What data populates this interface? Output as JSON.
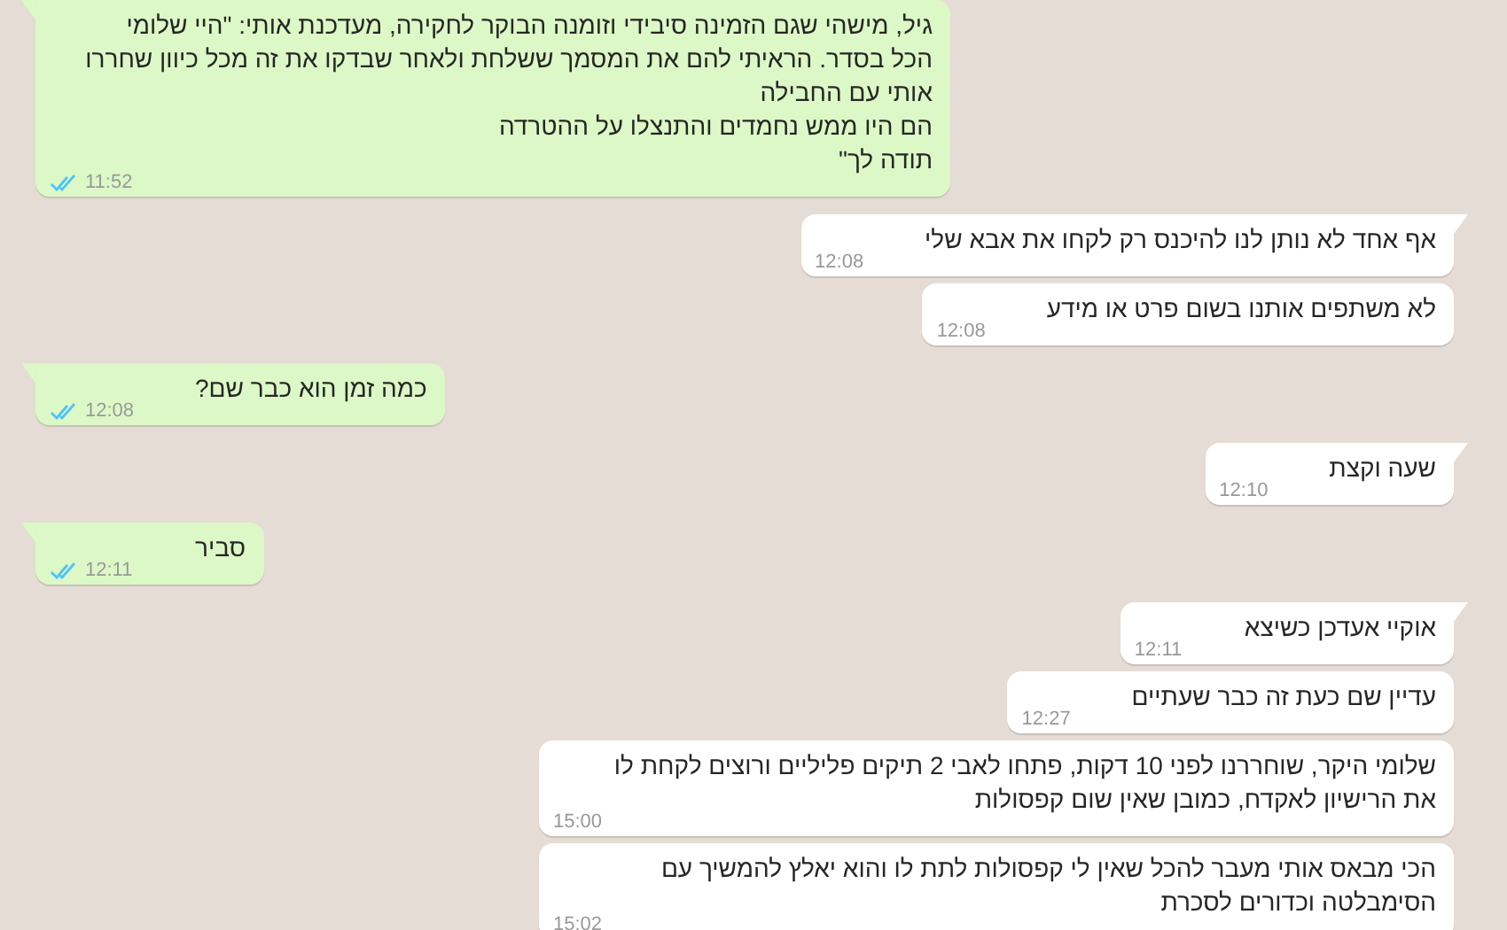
{
  "messages": [
    {
      "kind": "sent",
      "tail": true,
      "paragraphs": [
        "גיל, מישהי שגם הזמינה סיבידי וזומנה הבוקר לחקירה, מעדכנת אותי: \"היי שלומי הכל בסדר. הראיתי להם את המסמך ששלחת ולאחר שבדקו את זה מכל כיוון שחררו אותי עם החבילה",
        "הם היו ממש נחמדים והתנצלו על ההטרדה",
        "תודה לך\""
      ],
      "time": "11:52",
      "read": true
    },
    {
      "kind": "received",
      "tail": true,
      "paragraphs": [
        "אף אחד לא נותן לנו להיכנס רק לקחו את אבא שלי"
      ],
      "time": "12:08"
    },
    {
      "kind": "received",
      "tail": false,
      "paragraphs": [
        "לא משתפים אותנו בשום פרט או מידע"
      ],
      "time": "12:08"
    },
    {
      "kind": "sent",
      "tail": true,
      "paragraphs": [
        "כמה זמן הוא כבר שם?"
      ],
      "time": "12:08",
      "read": true
    },
    {
      "kind": "received",
      "tail": true,
      "paragraphs": [
        "שעה וקצת"
      ],
      "time": "12:10"
    },
    {
      "kind": "sent",
      "tail": true,
      "paragraphs": [
        "סביר"
      ],
      "time": "12:11",
      "read": true
    },
    {
      "kind": "received",
      "tail": true,
      "paragraphs": [
        "אוקיי אעדכן כשיצא"
      ],
      "time": "12:11"
    },
    {
      "kind": "received",
      "tail": false,
      "paragraphs": [
        "עדיין שם כעת זה כבר שעתיים"
      ],
      "time": "12:27"
    },
    {
      "kind": "received",
      "tail": false,
      "paragraphs": [
        "שלומי היקר, שוחררנו לפני 10 דקות, פתחו לאבי 2 תיקים פליליים ורוצים לקחת לו את הרישיון לאקדח, כמובן שאין שום קפסולות"
      ],
      "time": "15:00"
    },
    {
      "kind": "received",
      "tail": false,
      "paragraphs": [
        "הכי מבאס אותי מעבר להכל שאין לי קפסולות לתת לו והוא יאלץ להמשיך עם הסימבלטה וכדורים לסכרת"
      ],
      "time": "15:02"
    }
  ]
}
